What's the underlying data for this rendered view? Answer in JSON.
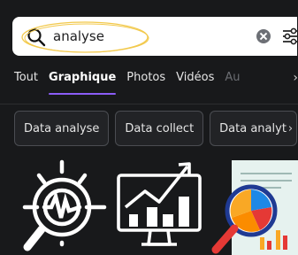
{
  "search": {
    "query": "analyse"
  },
  "tabs": [
    {
      "label": "Tout"
    },
    {
      "label": "Graphique"
    },
    {
      "label": "Photos"
    },
    {
      "label": "Vidéos"
    },
    {
      "label": "Au"
    }
  ],
  "chips": [
    {
      "label": "Data analyse"
    },
    {
      "label": "Data collect"
    },
    {
      "label": "Data analyt"
    }
  ],
  "colors": {
    "background": "#18191b",
    "accent": "#8b5cf6",
    "highlight_circle": "#f2c94c"
  },
  "icons": [
    "search-icon",
    "clear-icon",
    "filter-sliders-icon",
    "chevron-right-icon"
  ]
}
